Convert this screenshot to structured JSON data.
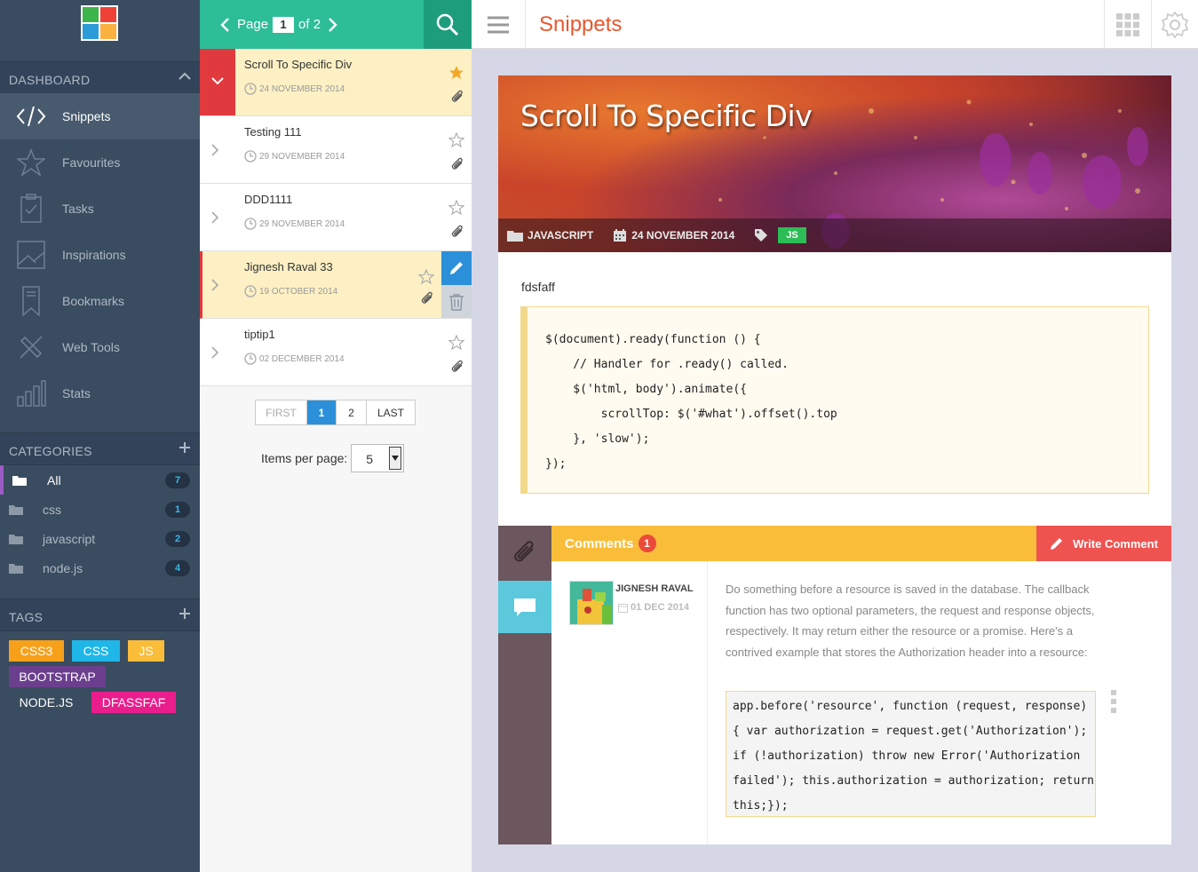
{
  "sidebar": {
    "dashboard_label": "DASHBOARD",
    "nav": [
      {
        "label": "Snippets",
        "icon": "code-icon"
      },
      {
        "label": "Favourites",
        "icon": "star-icon"
      },
      {
        "label": "Tasks",
        "icon": "clipboard-icon"
      },
      {
        "label": "Inspirations",
        "icon": "image-icon"
      },
      {
        "label": "Bookmarks",
        "icon": "bookmark-icon"
      },
      {
        "label": "Web Tools",
        "icon": "tools-icon"
      },
      {
        "label": "Stats",
        "icon": "bar-chart-icon"
      }
    ],
    "categories_label": "CATEGORIES",
    "categories": [
      {
        "name": "All",
        "count": "7"
      },
      {
        "name": "css",
        "count": "1"
      },
      {
        "name": "javascript",
        "count": "2"
      },
      {
        "name": "node.js",
        "count": "4"
      }
    ],
    "tags_label": "TAGS",
    "tags": [
      {
        "label": "CSS3",
        "color": "#f7a11a"
      },
      {
        "label": "CSS",
        "color": "#1fb6e8"
      },
      {
        "label": "JS",
        "color": "#f9bd3a"
      },
      {
        "label": "BOOTSTRAP",
        "color": "#6b3f8e"
      },
      {
        "label": "NODE.JS",
        "color": "#3a4c5f"
      },
      {
        "label": "DFASSFAF",
        "color": "#e91e8c"
      }
    ]
  },
  "pager": {
    "prefix": "Page",
    "current": "1",
    "suffix": "of 2"
  },
  "snippets": [
    {
      "title": "Scroll To Specific Div",
      "date": "24 NOVEMBER 2014",
      "starred": true
    },
    {
      "title": "Testing 111",
      "date": "29 NOVEMBER 2014",
      "starred": false
    },
    {
      "title": "DDD1111",
      "date": "29 NOVEMBER 2014",
      "starred": false
    },
    {
      "title": "Jignesh Raval 33",
      "date": "19 OCTOBER 2014",
      "starred": false
    },
    {
      "title": "tiptip1",
      "date": "02 DECEMBER 2014",
      "starred": false
    }
  ],
  "pagination": {
    "first": "FIRST",
    "p1": "1",
    "p2": "2",
    "last": "LAST"
  },
  "items_per_page": {
    "label": "Items per page:",
    "value": "5"
  },
  "topbar": {
    "title": "Snippets"
  },
  "detail": {
    "title": "Scroll To Specific Div",
    "category": "JAVASCRIPT",
    "date": "24 NOVEMBER 2014",
    "tag": "JS",
    "description": "fdsfaff",
    "code": "$(document).ready(function () {\n    // Handler for .ready() called.\n    $('html, body').animate({\n        scrollTop: $('#what').offset().top\n    }, 'slow');\n});"
  },
  "comments": {
    "label": "Comments",
    "count": "1",
    "write_label": "Write Comment",
    "author": "JIGNESH RAVAL",
    "date": "01 DEC 2014",
    "text": "Do something before a resource is saved in the database. The callback function has two optional parameters, the request and response objects, respectively. It may return either the resource or a promise. Here's a contrived example that stores the Authorization header into a resource:",
    "code": "app.before('resource', function (request, response) { var authorization = request.get('Authorization'); if (!authorization) throw new Error('Authorization failed'); this.authorization = authorization; return this;});"
  },
  "colors": {
    "accent_green": "#2dbd97",
    "accent_red": "#e8582f",
    "sidebar": "#3a4c5f",
    "comments_bar": "#f9bd3a"
  }
}
